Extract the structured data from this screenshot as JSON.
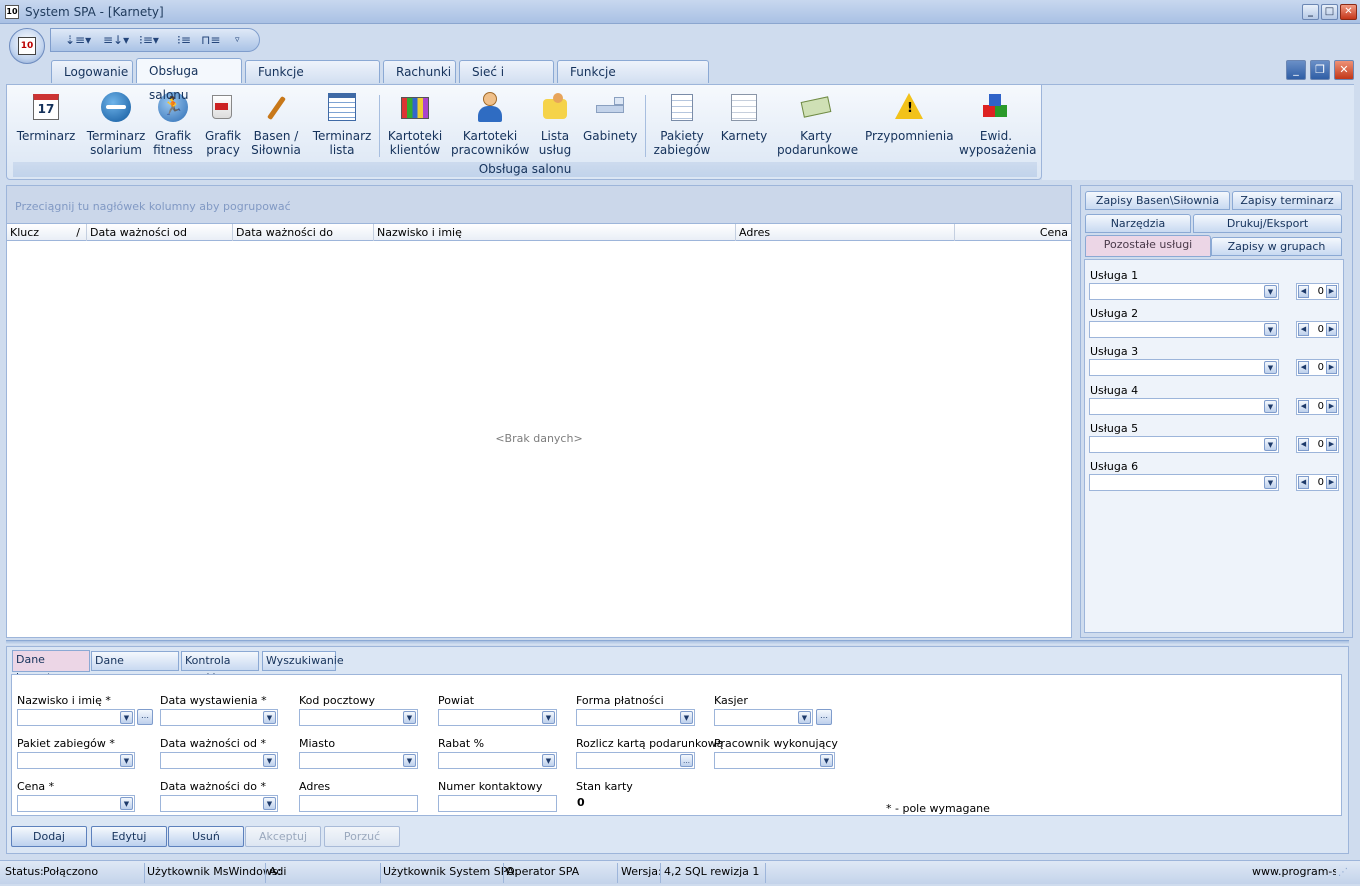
{
  "window": {
    "title": "System SPA  - [Karnety]",
    "app_icon_text": "10"
  },
  "quick_access": {
    "items": [
      "⇣≡▾",
      "≡↓▾",
      "⁝≡▾",
      "⁝≡",
      "⊓≡",
      "▿"
    ]
  },
  "tabs": [
    {
      "label": "Logowanie"
    },
    {
      "label": "Obsługa salonu"
    },
    {
      "label": "Funkcje managerskie"
    },
    {
      "label": "Rachunki"
    },
    {
      "label": "Sieć i internet"
    },
    {
      "label": "Funkcje administracyjne"
    }
  ],
  "ribbon": {
    "group_label": "Obsługa salonu",
    "buttons": [
      {
        "label": "Terminarz",
        "icon": "calendar-icon"
      },
      {
        "label": "Terminarz\nsolarium",
        "icon": "solarium-icon"
      },
      {
        "label": "Grafik\nfitness",
        "icon": "fitness-icon"
      },
      {
        "label": "Grafik\npracy",
        "icon": "work-mug-icon"
      },
      {
        "label": "Basen /\nSiłownia",
        "icon": "pool-gym-icon"
      },
      {
        "label": "Terminarz\nlista",
        "icon": "table-icon"
      },
      {
        "label": "Kartoteki\nklientów",
        "icon": "card-files-icon"
      },
      {
        "label": "Kartoteki\npracowników",
        "icon": "employee-icon"
      },
      {
        "label": "Lista\nusług",
        "icon": "services-icon"
      },
      {
        "label": "Gabinety",
        "icon": "bed-icon"
      },
      {
        "label": "Pakiety\nzabiegów",
        "icon": "packages-icon"
      },
      {
        "label": "Karnety",
        "icon": "list-doc-icon"
      },
      {
        "label": "Karty\npodarunkowe",
        "icon": "gift-card-icon"
      },
      {
        "label": "Przypomnienia",
        "icon": "warning-icon"
      },
      {
        "label": "Ewid.\nwyposażenia",
        "icon": "blocks-icon"
      }
    ]
  },
  "grid": {
    "group_hint": "Przeciągnij tu nagłówek kolumny aby pogrupować",
    "columns": [
      "Klucz",
      "Data ważności od",
      "Data ważności do",
      "Nazwisko i imię",
      "Adres",
      "Cena"
    ],
    "sort_glyph": "/",
    "empty_text": "<Brak danych>"
  },
  "side_tabs": {
    "row1": [
      "Zapisy Basen\\Siłownia",
      "Zapisy terminarz"
    ],
    "row2": [
      "Narzędzia",
      "Drukuj/Eksport"
    ],
    "row3": [
      "Pozostałe usługi",
      "Zapisy w grupach"
    ]
  },
  "services": [
    {
      "label": "Usługa 1",
      "value": "0"
    },
    {
      "label": "Usługa 2",
      "value": "0"
    },
    {
      "label": "Usługa 3",
      "value": "0"
    },
    {
      "label": "Usługa 4",
      "value": "0"
    },
    {
      "label": "Usługa 5",
      "value": "0"
    },
    {
      "label": "Usługa 6",
      "value": "0"
    }
  ],
  "bottom_tabs": [
    "Dane karnetu",
    "Dane dodatkowe",
    "Kontrola wejść",
    "Wyszukiwanie"
  ],
  "form": {
    "nazwisko": "Nazwisko i imię *",
    "data_wystawienia": "Data wystawienia *",
    "kod_pocztowy": "Kod pocztowy",
    "powiat": "Powiat",
    "forma_platnosci": "Forma płatności",
    "kasjer": "Kasjer",
    "pakiet": "Pakiet zabiegów *",
    "data_od": "Data ważności od *",
    "miasto": "Miasto",
    "rabat": "Rabat %",
    "rozlicz": "Rozlicz kartą podarunkową",
    "pracownik": "Pracownik wykonujący",
    "cena": "Cena *",
    "data_do": "Data ważności do *",
    "adres": "Adres",
    "numer": "Numer kontaktowy",
    "stan_karty": "Stan karty",
    "stan_karty_value": "0",
    "required_note": "* - pole wymagane"
  },
  "actions": {
    "add": "Dodaj",
    "edit": "Edytuj",
    "delete": "Usuń",
    "accept": "Akceptuj",
    "abandon": "Porzuć"
  },
  "status": {
    "status_label": "Status:",
    "status_value": "Połączono",
    "win_user_label": "Użytkownik MsWindows:",
    "win_user_value": "Adi",
    "spa_user_label": "Użytkownik System SPA:",
    "spa_user_value": "Operator SPA",
    "version_label": "Wersja:",
    "version_value": "4,2 SQL rewizja 1",
    "website": "www.program-spa.pl"
  },
  "colors": {
    "accent": "#15325b",
    "frame": "#cfdcee",
    "active_tab": "#ecd6e6"
  }
}
